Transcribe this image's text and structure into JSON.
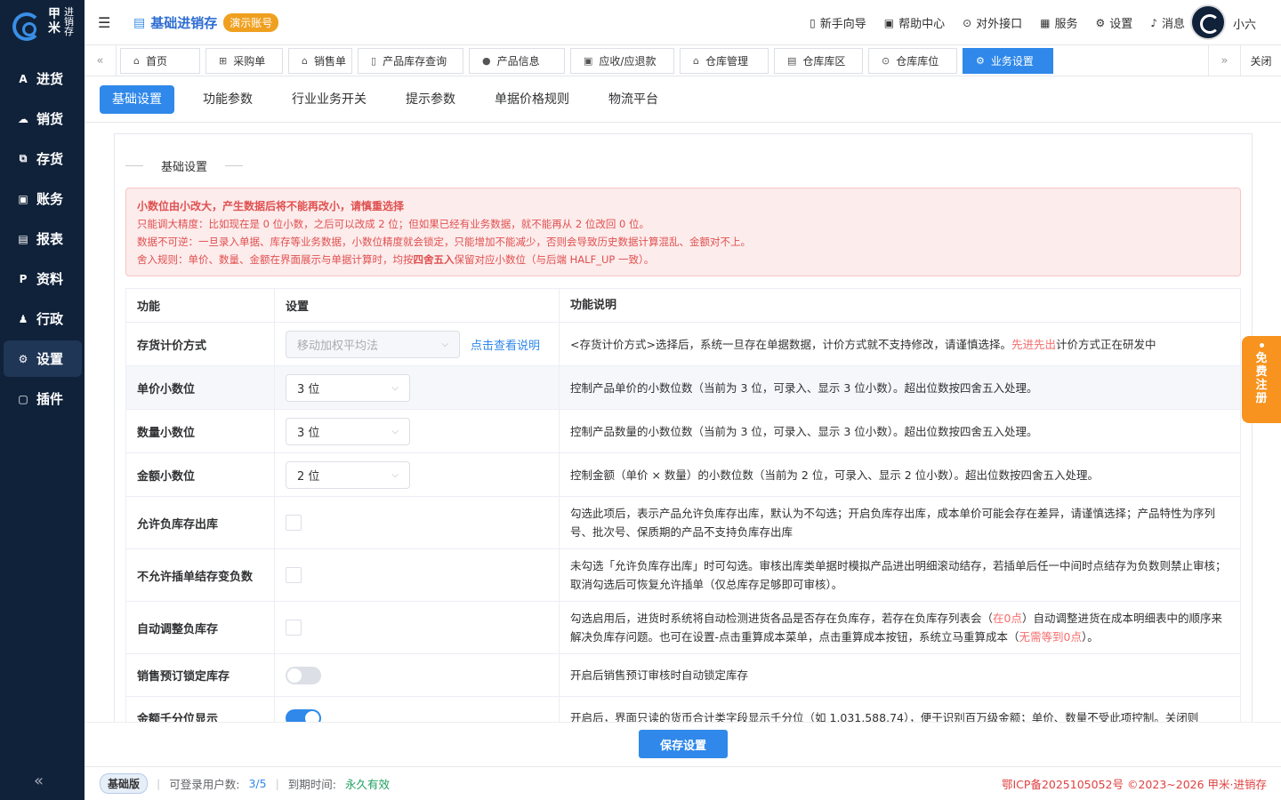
{
  "brand": {
    "big": "甲米",
    "small": "进销存"
  },
  "sidebar": {
    "items": [
      {
        "label": "进货",
        "icon": "purchase-icon",
        "glyph": "A"
      },
      {
        "label": "销货",
        "icon": "sales-icon",
        "glyph": "☁"
      },
      {
        "label": "存货",
        "icon": "inventory-icon",
        "glyph": "⧉"
      },
      {
        "label": "账务",
        "icon": "accounts-icon",
        "glyph": "▣"
      },
      {
        "label": "报表",
        "icon": "report-icon",
        "glyph": "▤"
      },
      {
        "label": "资料",
        "icon": "data-icon",
        "glyph": "P"
      },
      {
        "label": "行政",
        "icon": "admin-icon",
        "glyph": "♟"
      },
      {
        "label": "设置",
        "icon": "settings-icon",
        "glyph": "⚙"
      },
      {
        "label": "插件",
        "icon": "plugin-icon",
        "glyph": "▢"
      }
    ],
    "active_index": 7,
    "collapse_glyph": "«"
  },
  "header": {
    "menu_glyph": "☰",
    "title": "基础进销存",
    "badge": "演示账号",
    "links": [
      {
        "label": "新手向导",
        "icon": "guide-icon",
        "glyph": "▯"
      },
      {
        "label": "帮助中心",
        "icon": "help-icon",
        "glyph": "▣"
      },
      {
        "label": "对外接口",
        "icon": "api-icon",
        "glyph": "⊙"
      },
      {
        "label": "服务",
        "icon": "grid-icon",
        "glyph": "▦"
      },
      {
        "label": "设置",
        "icon": "gear-icon",
        "glyph": "⚙"
      },
      {
        "label": "消息",
        "icon": "bell-icon",
        "glyph": "♪"
      }
    ],
    "username": "小六"
  },
  "tabs": {
    "items": [
      {
        "label": "首页",
        "glyph": "⌂"
      },
      {
        "label": "采购单",
        "glyph": "⊞"
      },
      {
        "label": "销售单",
        "glyph": "⌂"
      },
      {
        "label": "产品库存查询",
        "glyph": "▯"
      },
      {
        "label": "产品信息",
        "glyph": "●"
      },
      {
        "label": "应收/应退款",
        "glyph": "▣"
      },
      {
        "label": "仓库管理",
        "glyph": "⌂"
      },
      {
        "label": "仓库库区",
        "glyph": "▤"
      },
      {
        "label": "仓库库位",
        "glyph": "⊙"
      },
      {
        "label": "业务设置",
        "glyph": "⚙"
      }
    ],
    "active_index": 9,
    "close_label": "关闭",
    "prev_glyph": "«",
    "next_glyph": "»"
  },
  "subtabs": {
    "items": [
      "基础设置",
      "功能参数",
      "行业业务开关",
      "提示参数",
      "单据价格规则",
      "物流平台"
    ],
    "active_index": 0
  },
  "section": {
    "title": "基础设置"
  },
  "alert": {
    "title": "小数位由小改大，产生数据后将不能再改小，请慎重选择",
    "lines": [
      "只能调大精度：比如现在是 0 位小数，之后可以改成 2 位；但如果已经有业务数据，就不能再从 2 位改回 0 位。",
      "数据不可逆：一旦录入单据、库存等业务数据，小数位精度就会锁定，只能增加不能减少，否则会导致历史数据计算混乱、金额对不上。"
    ],
    "line3_prefix": "舍入规则：单价、数量、金额在界面展示与单据计算时，均按",
    "line3_bold": "四舍五入",
    "line3_suffix": "保留对应小数位（与后端 HALF_UP 一致）。"
  },
  "table": {
    "headers": [
      "功能",
      "设置",
      "功能说明"
    ],
    "rows": {
      "pricing": {
        "label": "存货计价方式",
        "value": "移动加权平均法",
        "link": "点击查看说明",
        "desc_prefix": "<存货计价方式>选择后，系统一旦存在单据数据，计价方式就不支持修改，请谨慎选择。",
        "desc_red": "先进先出",
        "desc_suffix": "计价方式正在研发中"
      },
      "unit_price": {
        "label": "单价小数位",
        "value": "3 位",
        "desc": "控制产品单价的小数位数（当前为 3 位，可录入、显示 3 位小数）。超出位数按四舍五入处理。"
      },
      "quantity": {
        "label": "数量小数位",
        "value": "3 位",
        "desc": "控制产品数量的小数位数（当前为 3 位，可录入、显示 3 位小数）。超出位数按四舍五入处理。"
      },
      "amount": {
        "label": "金额小数位",
        "value": "2 位",
        "desc": "控制金额（单价 × 数量）的小数位数（当前为 2 位，可录入、显示 2 位小数）。超出位数按四舍五入处理。"
      },
      "negative": {
        "label": "允许负库存出库",
        "checked": false,
        "desc": "勾选此项后，表示产品允许负库存出库，默认为不勾选；开启负库存出库，成本单价可能会存在差异，请谨慎选择；产品特性为序列号、批次号、保质期的产品不支持负库存出库"
      },
      "no_insert": {
        "label": "不允许插单结存变负数",
        "checked": false,
        "desc": "未勾选「允许负库存出库」时可勾选。审核出库类单据时模拟产品进出明细滚动结存，若插单后任一中间时点结存为负数则禁止审核；取消勾选后可恢复允许插单（仅总库存足够即可审核）。"
      },
      "auto_adjust": {
        "label": "自动调整负库存",
        "checked": false,
        "desc_a": "勾选启用后，进货时系统将自动检测进货各品是否存在负库存，若存在负库存列表会（",
        "desc_red1": "在0点",
        "desc_b": "）自动调整进货在成本明细表中的顺序来解决负库存问题。也可在设置-点击重算成本菜单，点击重算成本按钮，系统立马重算成本（",
        "desc_red2": "无需等到0点",
        "desc_c": "）。"
      },
      "presale_lock": {
        "label": "销售预订锁定库存",
        "on": false,
        "desc": "开启后销售预订审核时自动锁定库存"
      },
      "thousands": {
        "label": "金额千分位显示",
        "on": true,
        "desc": "开启后，界面只读的货币合计类字段显示千分位（如 1,031,588.74），便于识别百万级金额；单价、数量不受此项控制。关闭则"
      }
    }
  },
  "save_button": "保存设置",
  "status": {
    "plan": "基础版",
    "users_label": "可登录用户数:",
    "users_value": "3/5",
    "expire_label": "到期时间:",
    "expire_value": "永久有效",
    "icp": "鄂ICP备2025105052号 ©2023~2026 甲米·进销存"
  },
  "float_register": {
    "label": "免费注册"
  },
  "colors": {
    "primary": "#2f88ea",
    "sidebar": "#10223a",
    "badge": "#f0a020",
    "danger": "#f56c6c",
    "success": "#20a060",
    "float": "#f7931e"
  }
}
